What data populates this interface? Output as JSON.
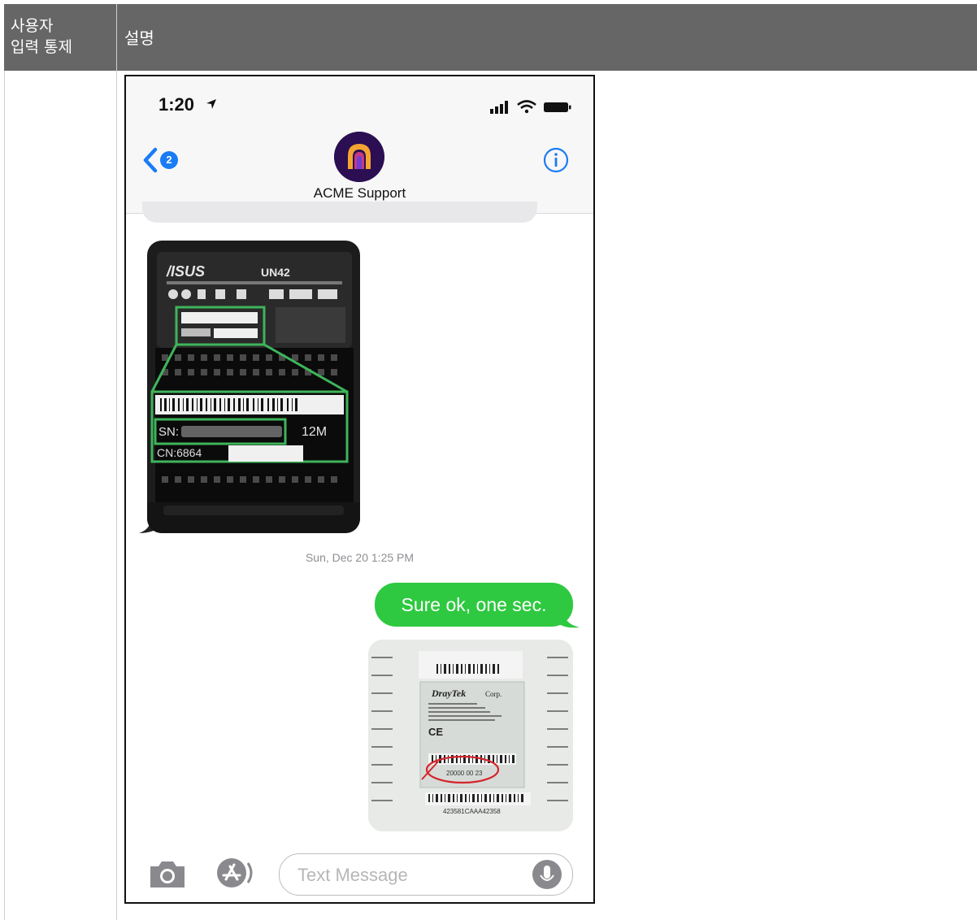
{
  "table": {
    "header_col1": "사용자\n입력 통제",
    "header_col2": "설명"
  },
  "phone": {
    "status": {
      "time": "1:20"
    },
    "nav": {
      "badge_count": "2",
      "contact_name": "ACME Support"
    },
    "messages": {
      "received_image_caption": "",
      "timestamp": "Sun, Dec 20 1:25 PM",
      "sent_text": "Sure ok, one sec."
    },
    "image1_labels": {
      "brand": "/ISUS",
      "model": "UN42",
      "sn": "SN:",
      "sn_suffix": "12M",
      "cn": "CN:6864"
    },
    "image2_labels": {
      "brand": "DrayTek",
      "corp": "Corp.",
      "serial": "20000 00 23",
      "bottom_code": "423581CAAA42358"
    },
    "input": {
      "placeholder": "Text Message"
    }
  }
}
